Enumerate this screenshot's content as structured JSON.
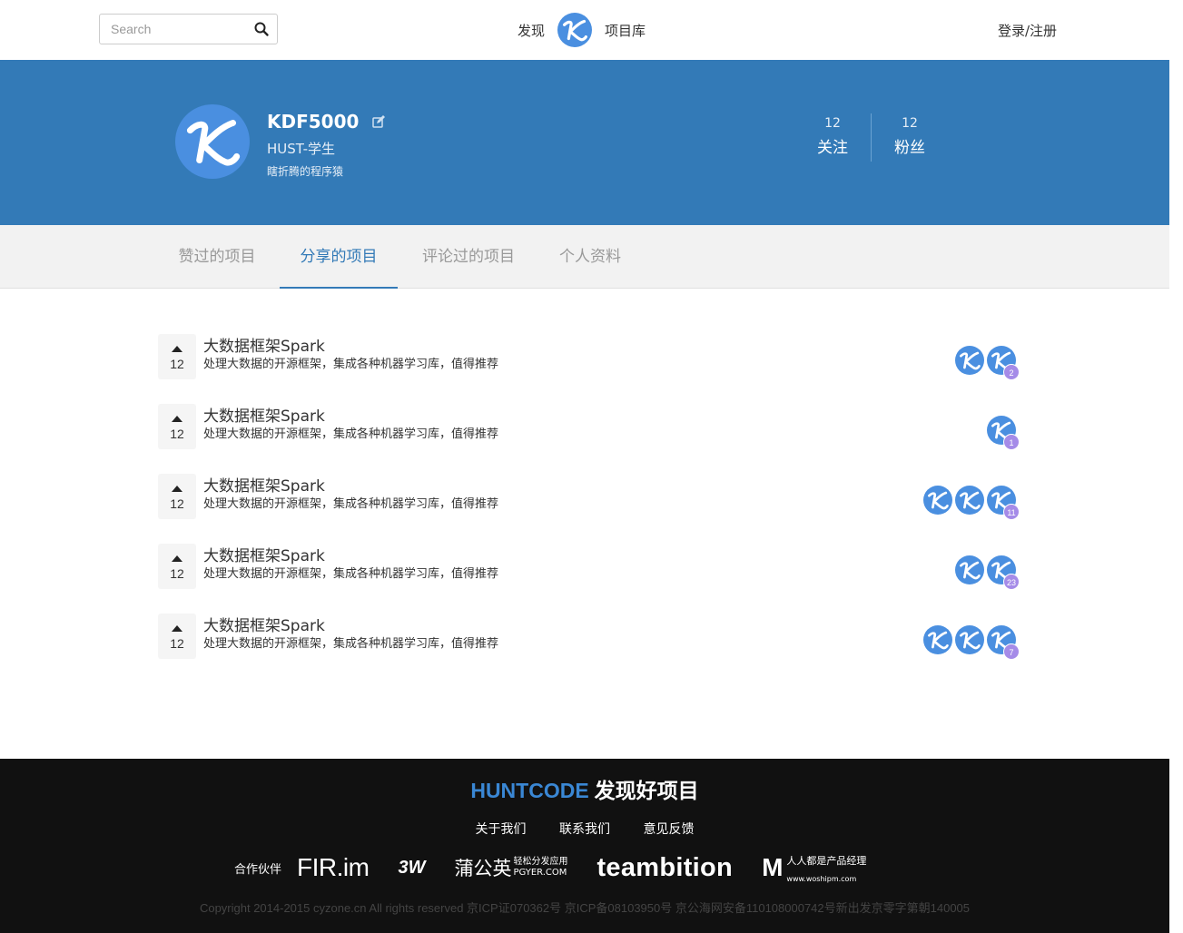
{
  "header": {
    "search_placeholder": "Search",
    "nav_discover": "发现",
    "nav_library": "项目库",
    "login": "登录/注册"
  },
  "profile": {
    "name": "KDF5000",
    "school": "HUST-学生",
    "bio": "瞎折腾的程序猿",
    "following_count": "12",
    "following_label": "关注",
    "followers_count": "12",
    "followers_label": "粉丝"
  },
  "tabs": [
    {
      "label": "赞过的项目",
      "active": false
    },
    {
      "label": "分享的项目",
      "active": true
    },
    {
      "label": "评论过的项目",
      "active": false
    },
    {
      "label": "个人资料",
      "active": false
    }
  ],
  "projects": [
    {
      "votes": "12",
      "title": "大数据框架Spark",
      "desc": "处理大数据的开源框架，集成各种机器学习库，值得推荐",
      "avatar_count": 2,
      "badge": "2"
    },
    {
      "votes": "12",
      "title": "大数据框架Spark",
      "desc": "处理大数据的开源框架，集成各种机器学习库，值得推荐",
      "avatar_count": 1,
      "badge": "1"
    },
    {
      "votes": "12",
      "title": "大数据框架Spark",
      "desc": "处理大数据的开源框架，集成各种机器学习库，值得推荐",
      "avatar_count": 3,
      "badge": "11"
    },
    {
      "votes": "12",
      "title": "大数据框架Spark",
      "desc": "处理大数据的开源框架，集成各种机器学习库，值得推荐",
      "avatar_count": 2,
      "badge": "23"
    },
    {
      "votes": "12",
      "title": "大数据框架Spark",
      "desc": "处理大数据的开源框架，集成各种机器学习库，值得推荐",
      "avatar_count": 3,
      "badge": "7"
    }
  ],
  "footer": {
    "brand_en": "HUNTCODE",
    "brand_zh": "发现好项目",
    "links": [
      "关于我们",
      "联系我们",
      "意见反馈"
    ],
    "partners_label": "合作伙伴",
    "partners": {
      "fir": "FIR.im",
      "threew": "3W",
      "pgyer_main": "蒲公英",
      "pgyer_sub": "轻松分发应用",
      "pgyer_url": "PGYER.COM",
      "teambition": "teambition",
      "woshipm_text": "人人都是产品经理",
      "woshipm_url": "www.woshipm.com"
    },
    "copyright": "Copyright 2014-2015 cyzone.cn All rights reserved 京ICP证070362号 京ICP备08103950号 京公海网安备110108000742号新出发京零字第朝140005"
  },
  "colors": {
    "primary": "#337ab7",
    "badge": "#a58be8",
    "avatar_blue": "#4a8fe0",
    "footer_bg": "#111111"
  },
  "icons": {
    "search": "search-icon",
    "logo": "k-logo-icon",
    "edit": "edit-icon",
    "upvote": "upvote-triangle-icon"
  }
}
